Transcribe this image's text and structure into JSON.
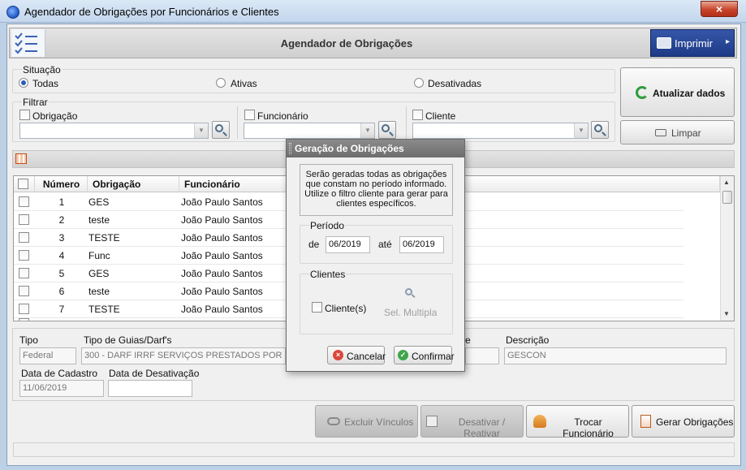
{
  "window": {
    "title": "Agendador de Obrigações por Funcionários e Clientes",
    "close_glyph": "×"
  },
  "header": {
    "title": "Agendador de Obrigações",
    "print_label": "Imprimir",
    "print_arrow": "▸"
  },
  "situacao": {
    "label": "Situação",
    "options": [
      {
        "label": "Todas",
        "selected": true
      },
      {
        "label": "Ativas",
        "selected": false
      },
      {
        "label": "Desativadas",
        "selected": false
      }
    ]
  },
  "filtrar": {
    "label": "Filtrar",
    "obrigacao": "Obrigação",
    "funcionario": "Funcionário",
    "cliente": "Cliente"
  },
  "side_buttons": {
    "atualizar": "Atualizar dados",
    "limpar": "Limpar"
  },
  "grid": {
    "columns": [
      "Número",
      "Obrigação",
      "Funcionário"
    ],
    "rows": [
      {
        "numero": "1",
        "obrigacao": "GES",
        "funcionario": "João Paulo Santos"
      },
      {
        "numero": "2",
        "obrigacao": "teste",
        "funcionario": "João Paulo Santos"
      },
      {
        "numero": "3",
        "obrigacao": "TESTE",
        "funcionario": "João Paulo Santos"
      },
      {
        "numero": "4",
        "obrigacao": "Func",
        "funcionario": "João Paulo Santos"
      },
      {
        "numero": "5",
        "obrigacao": "GES",
        "funcionario": "João Paulo Santos"
      },
      {
        "numero": "6",
        "obrigacao": "teste",
        "funcionario": "João Paulo Santos"
      },
      {
        "numero": "7",
        "obrigacao": "TESTE",
        "funcionario": "João Paulo Santos"
      }
    ]
  },
  "details": {
    "tipo_label": "Tipo",
    "tipo_value": "Federal",
    "guias_label": "Tipo de Guias/Darf's",
    "guias_value": "300 - DARF IRRF SERVIÇOS PRESTADOS POR PJ - C",
    "partial_label": "e",
    "descricao_label": "Descrição",
    "descricao_value": "GESCON",
    "cadastro_label": "Data de Cadastro",
    "cadastro_value": "11/06/2019",
    "desativacao_label": "Data de Desativação",
    "desativacao_value": ""
  },
  "bottom_buttons": {
    "excluir": "Excluir Vínculos",
    "desativar": "Desativar / Reativar",
    "trocar": "Trocar Funcionário",
    "gerar": "Gerar Obrigações"
  },
  "dialog": {
    "title": "Geração de Obrigações",
    "info": "Serão geradas todas as obrigações que constam no período informado. Utilize o filtro cliente para gerar para clientes específicos.",
    "periodo_label": "Período",
    "de_label": "de",
    "de_value": "06/2019",
    "ate_label": "até",
    "ate_value": "06/2019",
    "clientes_label": "Clientes",
    "clientes_check": "Cliente(s)",
    "sel_multipla": "Sel. Multipla",
    "cancelar": "Cancelar",
    "confirmar": "Confirmar"
  }
}
